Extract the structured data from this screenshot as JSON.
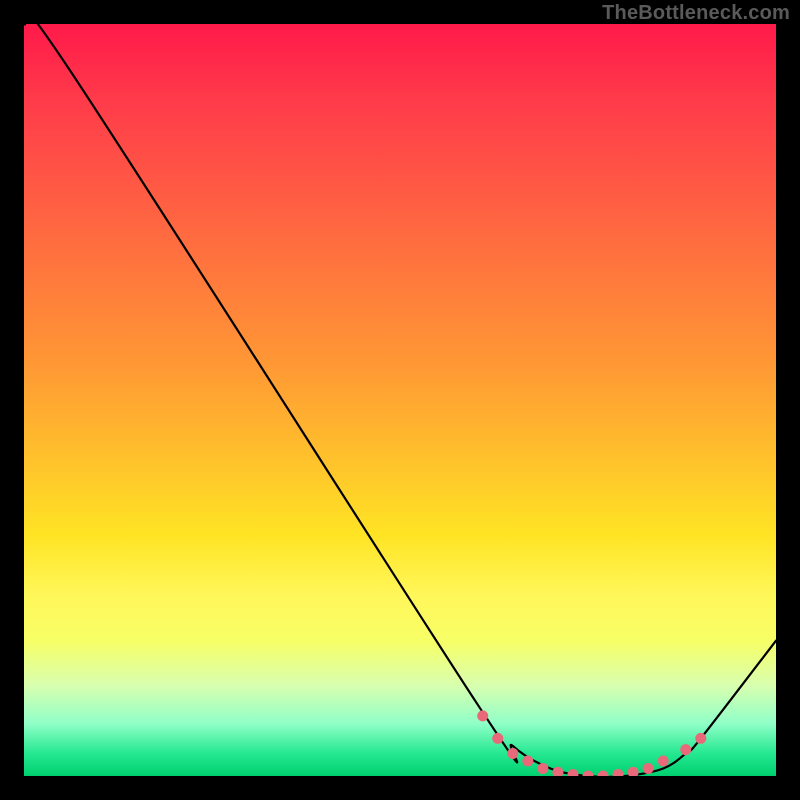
{
  "watermark": "TheBottleneck.com",
  "chart_data": {
    "type": "line",
    "title": "",
    "xlabel": "",
    "ylabel": "",
    "xlim": [
      0,
      100
    ],
    "ylim": [
      0,
      100
    ],
    "series": [
      {
        "name": "bottleneck-curve",
        "x": [
          0,
          6,
          60,
          65,
          70,
          75,
          80,
          85,
          88,
          90,
          100
        ],
        "y": [
          100,
          94,
          10,
          4,
          1,
          0,
          0,
          1,
          3,
          5,
          18
        ]
      }
    ],
    "markers": {
      "name": "zero-zone-dots",
      "color": "#e86a7a",
      "points": [
        {
          "x": 61,
          "y": 8
        },
        {
          "x": 63,
          "y": 5
        },
        {
          "x": 65,
          "y": 3
        },
        {
          "x": 67,
          "y": 2
        },
        {
          "x": 69,
          "y": 1
        },
        {
          "x": 71,
          "y": 0.5
        },
        {
          "x": 73,
          "y": 0.2
        },
        {
          "x": 75,
          "y": 0
        },
        {
          "x": 77,
          "y": 0
        },
        {
          "x": 79,
          "y": 0.2
        },
        {
          "x": 81,
          "y": 0.5
        },
        {
          "x": 83,
          "y": 1
        },
        {
          "x": 85,
          "y": 2
        },
        {
          "x": 88,
          "y": 3.5
        },
        {
          "x": 90,
          "y": 5
        }
      ]
    },
    "gradient_bands": [
      {
        "y": 100,
        "color": "#ff1a4a"
      },
      {
        "y": 50,
        "color": "#ffb030"
      },
      {
        "y": 20,
        "color": "#fff040"
      },
      {
        "y": 5,
        "color": "#b0ffb0"
      },
      {
        "y": 0,
        "color": "#00d070"
      }
    ]
  }
}
